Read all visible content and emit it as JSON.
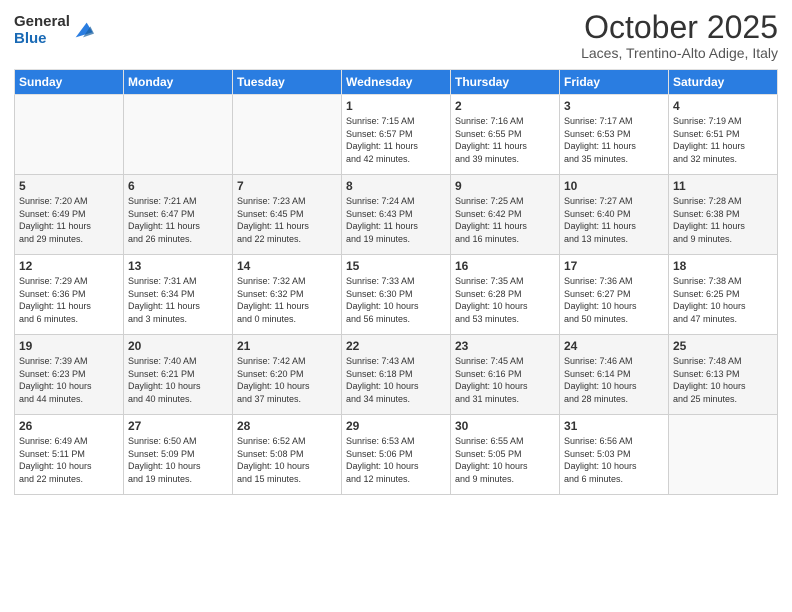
{
  "header": {
    "logo_general": "General",
    "logo_blue": "Blue",
    "month": "October 2025",
    "location": "Laces, Trentino-Alto Adige, Italy"
  },
  "weekdays": [
    "Sunday",
    "Monday",
    "Tuesday",
    "Wednesday",
    "Thursday",
    "Friday",
    "Saturday"
  ],
  "weeks": [
    [
      {
        "day": "",
        "info": ""
      },
      {
        "day": "",
        "info": ""
      },
      {
        "day": "",
        "info": ""
      },
      {
        "day": "1",
        "info": "Sunrise: 7:15 AM\nSunset: 6:57 PM\nDaylight: 11 hours\nand 42 minutes."
      },
      {
        "day": "2",
        "info": "Sunrise: 7:16 AM\nSunset: 6:55 PM\nDaylight: 11 hours\nand 39 minutes."
      },
      {
        "day": "3",
        "info": "Sunrise: 7:17 AM\nSunset: 6:53 PM\nDaylight: 11 hours\nand 35 minutes."
      },
      {
        "day": "4",
        "info": "Sunrise: 7:19 AM\nSunset: 6:51 PM\nDaylight: 11 hours\nand 32 minutes."
      }
    ],
    [
      {
        "day": "5",
        "info": "Sunrise: 7:20 AM\nSunset: 6:49 PM\nDaylight: 11 hours\nand 29 minutes."
      },
      {
        "day": "6",
        "info": "Sunrise: 7:21 AM\nSunset: 6:47 PM\nDaylight: 11 hours\nand 26 minutes."
      },
      {
        "day": "7",
        "info": "Sunrise: 7:23 AM\nSunset: 6:45 PM\nDaylight: 11 hours\nand 22 minutes."
      },
      {
        "day": "8",
        "info": "Sunrise: 7:24 AM\nSunset: 6:43 PM\nDaylight: 11 hours\nand 19 minutes."
      },
      {
        "day": "9",
        "info": "Sunrise: 7:25 AM\nSunset: 6:42 PM\nDaylight: 11 hours\nand 16 minutes."
      },
      {
        "day": "10",
        "info": "Sunrise: 7:27 AM\nSunset: 6:40 PM\nDaylight: 11 hours\nand 13 minutes."
      },
      {
        "day": "11",
        "info": "Sunrise: 7:28 AM\nSunset: 6:38 PM\nDaylight: 11 hours\nand 9 minutes."
      }
    ],
    [
      {
        "day": "12",
        "info": "Sunrise: 7:29 AM\nSunset: 6:36 PM\nDaylight: 11 hours\nand 6 minutes."
      },
      {
        "day": "13",
        "info": "Sunrise: 7:31 AM\nSunset: 6:34 PM\nDaylight: 11 hours\nand 3 minutes."
      },
      {
        "day": "14",
        "info": "Sunrise: 7:32 AM\nSunset: 6:32 PM\nDaylight: 11 hours\nand 0 minutes."
      },
      {
        "day": "15",
        "info": "Sunrise: 7:33 AM\nSunset: 6:30 PM\nDaylight: 10 hours\nand 56 minutes."
      },
      {
        "day": "16",
        "info": "Sunrise: 7:35 AM\nSunset: 6:28 PM\nDaylight: 10 hours\nand 53 minutes."
      },
      {
        "day": "17",
        "info": "Sunrise: 7:36 AM\nSunset: 6:27 PM\nDaylight: 10 hours\nand 50 minutes."
      },
      {
        "day": "18",
        "info": "Sunrise: 7:38 AM\nSunset: 6:25 PM\nDaylight: 10 hours\nand 47 minutes."
      }
    ],
    [
      {
        "day": "19",
        "info": "Sunrise: 7:39 AM\nSunset: 6:23 PM\nDaylight: 10 hours\nand 44 minutes."
      },
      {
        "day": "20",
        "info": "Sunrise: 7:40 AM\nSunset: 6:21 PM\nDaylight: 10 hours\nand 40 minutes."
      },
      {
        "day": "21",
        "info": "Sunrise: 7:42 AM\nSunset: 6:20 PM\nDaylight: 10 hours\nand 37 minutes."
      },
      {
        "day": "22",
        "info": "Sunrise: 7:43 AM\nSunset: 6:18 PM\nDaylight: 10 hours\nand 34 minutes."
      },
      {
        "day": "23",
        "info": "Sunrise: 7:45 AM\nSunset: 6:16 PM\nDaylight: 10 hours\nand 31 minutes."
      },
      {
        "day": "24",
        "info": "Sunrise: 7:46 AM\nSunset: 6:14 PM\nDaylight: 10 hours\nand 28 minutes."
      },
      {
        "day": "25",
        "info": "Sunrise: 7:48 AM\nSunset: 6:13 PM\nDaylight: 10 hours\nand 25 minutes."
      }
    ],
    [
      {
        "day": "26",
        "info": "Sunrise: 6:49 AM\nSunset: 5:11 PM\nDaylight: 10 hours\nand 22 minutes."
      },
      {
        "day": "27",
        "info": "Sunrise: 6:50 AM\nSunset: 5:09 PM\nDaylight: 10 hours\nand 19 minutes."
      },
      {
        "day": "28",
        "info": "Sunrise: 6:52 AM\nSunset: 5:08 PM\nDaylight: 10 hours\nand 15 minutes."
      },
      {
        "day": "29",
        "info": "Sunrise: 6:53 AM\nSunset: 5:06 PM\nDaylight: 10 hours\nand 12 minutes."
      },
      {
        "day": "30",
        "info": "Sunrise: 6:55 AM\nSunset: 5:05 PM\nDaylight: 10 hours\nand 9 minutes."
      },
      {
        "day": "31",
        "info": "Sunrise: 6:56 AM\nSunset: 5:03 PM\nDaylight: 10 hours\nand 6 minutes."
      },
      {
        "day": "",
        "info": ""
      }
    ]
  ]
}
